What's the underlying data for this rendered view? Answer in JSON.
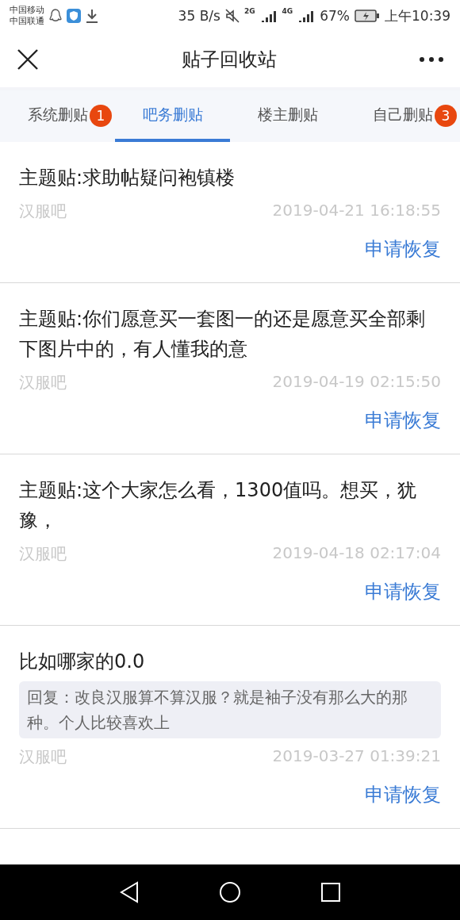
{
  "status_bar": {
    "carriers": [
      "中国移动",
      "中国联通"
    ],
    "speed": "35 B/s",
    "network_1": "2G",
    "network_2": "4G",
    "battery": "67%",
    "time": "上午10:39"
  },
  "header": {
    "title": "贴子回收站"
  },
  "tabs": [
    {
      "label": "系统删贴",
      "selected": false,
      "badge": "1"
    },
    {
      "label": "吧务删贴",
      "selected": true
    },
    {
      "label": "楼主删贴",
      "selected": false
    },
    {
      "label": "自己删贴",
      "selected": false,
      "badge": "3"
    }
  ],
  "posts": [
    {
      "title": "主题贴:求助帖疑问袍镇楼",
      "forum": "汉服吧",
      "time": "2019-04-21 16:18:55",
      "action": "申请恢复"
    },
    {
      "title": "主题贴:你们愿意买一套图一的还是愿意买全部剩下图片中的，有人懂我的意",
      "forum": "汉服吧",
      "time": "2019-04-19 02:15:50",
      "action": "申请恢复"
    },
    {
      "title": "主题贴:这个大家怎么看，1300值吗。想买，犹豫，",
      "forum": "汉服吧",
      "time": "2019-04-18 02:17:04",
      "action": "申请恢复"
    },
    {
      "title": "比如哪家的0.0",
      "reply": "回复：改良汉服算不算汉服？就是袖子没有那么大的那种。个人比较喜欢上",
      "forum": "汉服吧",
      "time": "2019-03-27 01:39:21",
      "action": "申请恢复"
    }
  ]
}
